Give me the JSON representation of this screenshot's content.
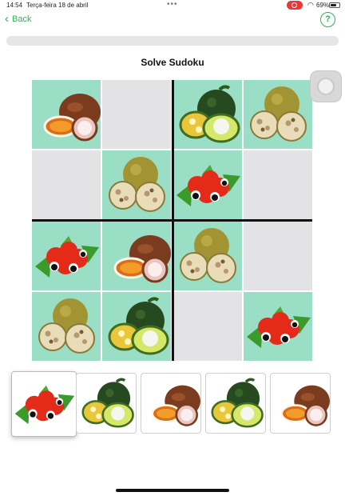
{
  "status_bar": {
    "time": "14:54",
    "date": "Terça-feira 18 de abril",
    "battery": "69%",
    "battery_level": 0.69
  },
  "nav": {
    "back_label": "Back",
    "help_label": "?"
  },
  "progress": {
    "value": 0
  },
  "title": "Solve Sudoku",
  "colors": {
    "accent": "#2fb25a",
    "cell_fill": "#9adfc5",
    "cell_empty": "#e3e3e6"
  },
  "board": {
    "size": 4,
    "cells": [
      [
        "passion-fruit",
        null,
        "sapote-lime",
        "longan"
      ],
      [
        null,
        "longan",
        "guarana",
        null
      ],
      [
        "guarana",
        "passion-fruit",
        "longan",
        null
      ],
      [
        "longan",
        "sapote-lime",
        null,
        "guarana"
      ]
    ]
  },
  "tray": {
    "selected_index": 0,
    "pieces": [
      "guarana",
      "sapote-lime",
      "passion-fruit",
      "sapote-lime",
      "passion-fruit"
    ]
  }
}
